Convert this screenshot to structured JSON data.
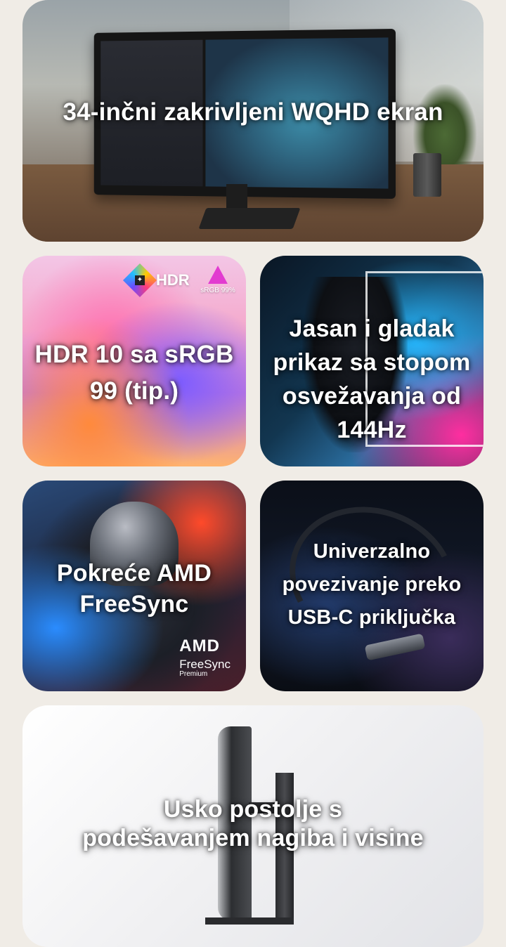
{
  "cards": [
    {
      "caption": "34-inčni zakrivljeni WQHD ekran"
    },
    {
      "caption_line1": "HDR 10 sa sRGB",
      "caption_line2": "99 (tip.)",
      "badge_hdr": "HDR",
      "badge_srgb": "sRGB 99%"
    },
    {
      "caption_line1": "Jasan i gladak",
      "caption_line2": "prikaz sa stopom",
      "caption_line3": "osvežavanja od",
      "caption_line4": "144Hz"
    },
    {
      "caption_line1": "Pokreće AMD",
      "caption_line2": "FreeSync",
      "logo_amd": "AMD",
      "logo_freesync": "FreeSync",
      "logo_premium": "Premium"
    },
    {
      "caption_line1": "Univerzalno",
      "caption_line2": "povezivanje preko",
      "caption_line3": "USB-C priključka"
    },
    {
      "caption_line1": "Usko postolje s",
      "caption_line2": "podešavanjem nagiba i visine"
    }
  ],
  "colors": {
    "page_background": "#f0ece6",
    "caption_text": "#ffffff"
  },
  "icons": [
    "hdr-logo-icon",
    "srgb-triangle-icon",
    "amd-freesync-premium-logo"
  ]
}
